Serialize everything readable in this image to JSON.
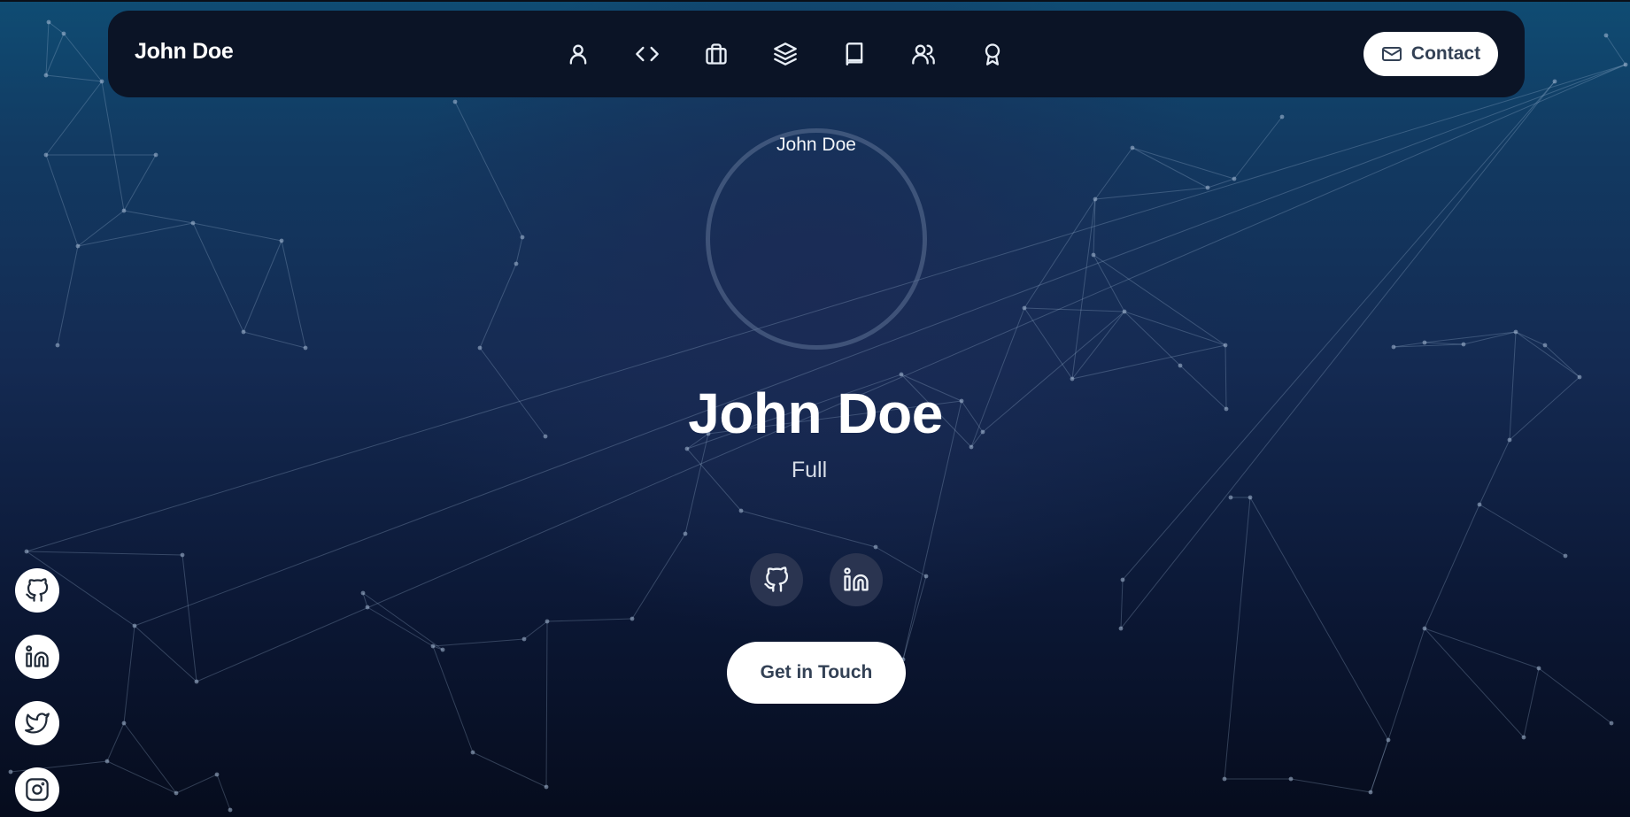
{
  "brand": "John Doe",
  "nav": {
    "items": [
      {
        "icon": "user-icon"
      },
      {
        "icon": "code-icon"
      },
      {
        "icon": "briefcase-icon"
      },
      {
        "icon": "layers-icon"
      },
      {
        "icon": "book-icon"
      },
      {
        "icon": "users-icon"
      },
      {
        "icon": "award-icon"
      }
    ],
    "contact_label": "Contact",
    "contact_icon": "mail-icon"
  },
  "hero": {
    "avatar_alt": "John Doe",
    "name": "John Doe",
    "role": "Full",
    "social": [
      {
        "icon": "github-icon"
      },
      {
        "icon": "linkedin-icon"
      }
    ],
    "cta_label": "Get in Touch"
  },
  "side_social": [
    {
      "icon": "github-icon"
    },
    {
      "icon": "linkedin-icon"
    },
    {
      "icon": "twitter-icon"
    },
    {
      "icon": "instagram-icon"
    }
  ],
  "colors": {
    "navbar": "#0b1426",
    "button_bg": "#ffffff",
    "button_text": "#334155",
    "background_top": "#0f4c73",
    "background_bottom": "#060c1d"
  }
}
